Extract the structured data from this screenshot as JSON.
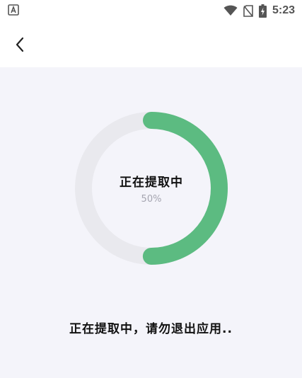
{
  "status_bar": {
    "time": "5:23",
    "icons": [
      "app-notification-icon",
      "wifi-icon",
      "no-sim-icon",
      "battery-charging-icon"
    ]
  },
  "header": {
    "back_icon": "chevron-left-icon"
  },
  "progress": {
    "title": "正在提取中",
    "percent_label": "50%",
    "value": 0.5,
    "track_color": "#e9e9ee",
    "fill_color": "#5cbb81"
  },
  "notice": {
    "text": "正在提取中，请勿退出应用.."
  },
  "colors": {
    "background": "#f4f4fa",
    "header_background": "#ffffff",
    "accent": "#5cbb81"
  }
}
